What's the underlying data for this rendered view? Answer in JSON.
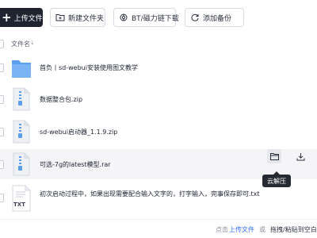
{
  "toolbar": {
    "upload_label": "上传文件",
    "new_folder_label": "新建文件夹",
    "bt_label": "BT/磁力链下载",
    "backup_label": "添加备份"
  },
  "list_header": {
    "name_label": "文件名",
    "sort_indicator": "⇣"
  },
  "files": [
    {
      "name": "首负丨sd-webui安装使用图文教学",
      "type": "folder-icon"
    },
    {
      "name": "数据整合包.zip",
      "type": "zip-icon"
    },
    {
      "name": "sd-webui启动器_1.1.9.zip",
      "type": "zip-icon"
    },
    {
      "name": "可选-7g的latest模型.rar",
      "type": "zip-icon"
    },
    {
      "name": "初次启动过程中，如果出现需要配合输入文字的，打字输入，完事保存即可.txt",
      "type": "txt-icon",
      "icon_text": "TXT"
    }
  ],
  "row_actions": {
    "tooltip": "云解压"
  },
  "footer": {
    "click_label": "点击",
    "upload_link": "上传文件",
    "or_label": "或",
    "drag_label": "拖拽/粘贴到空白"
  },
  "colors": {
    "primary_dark": "#1f2430",
    "accent_blue": "#3370ff",
    "folder_blue": "#5aa0ef",
    "hover_row": "#f5f5f7"
  }
}
